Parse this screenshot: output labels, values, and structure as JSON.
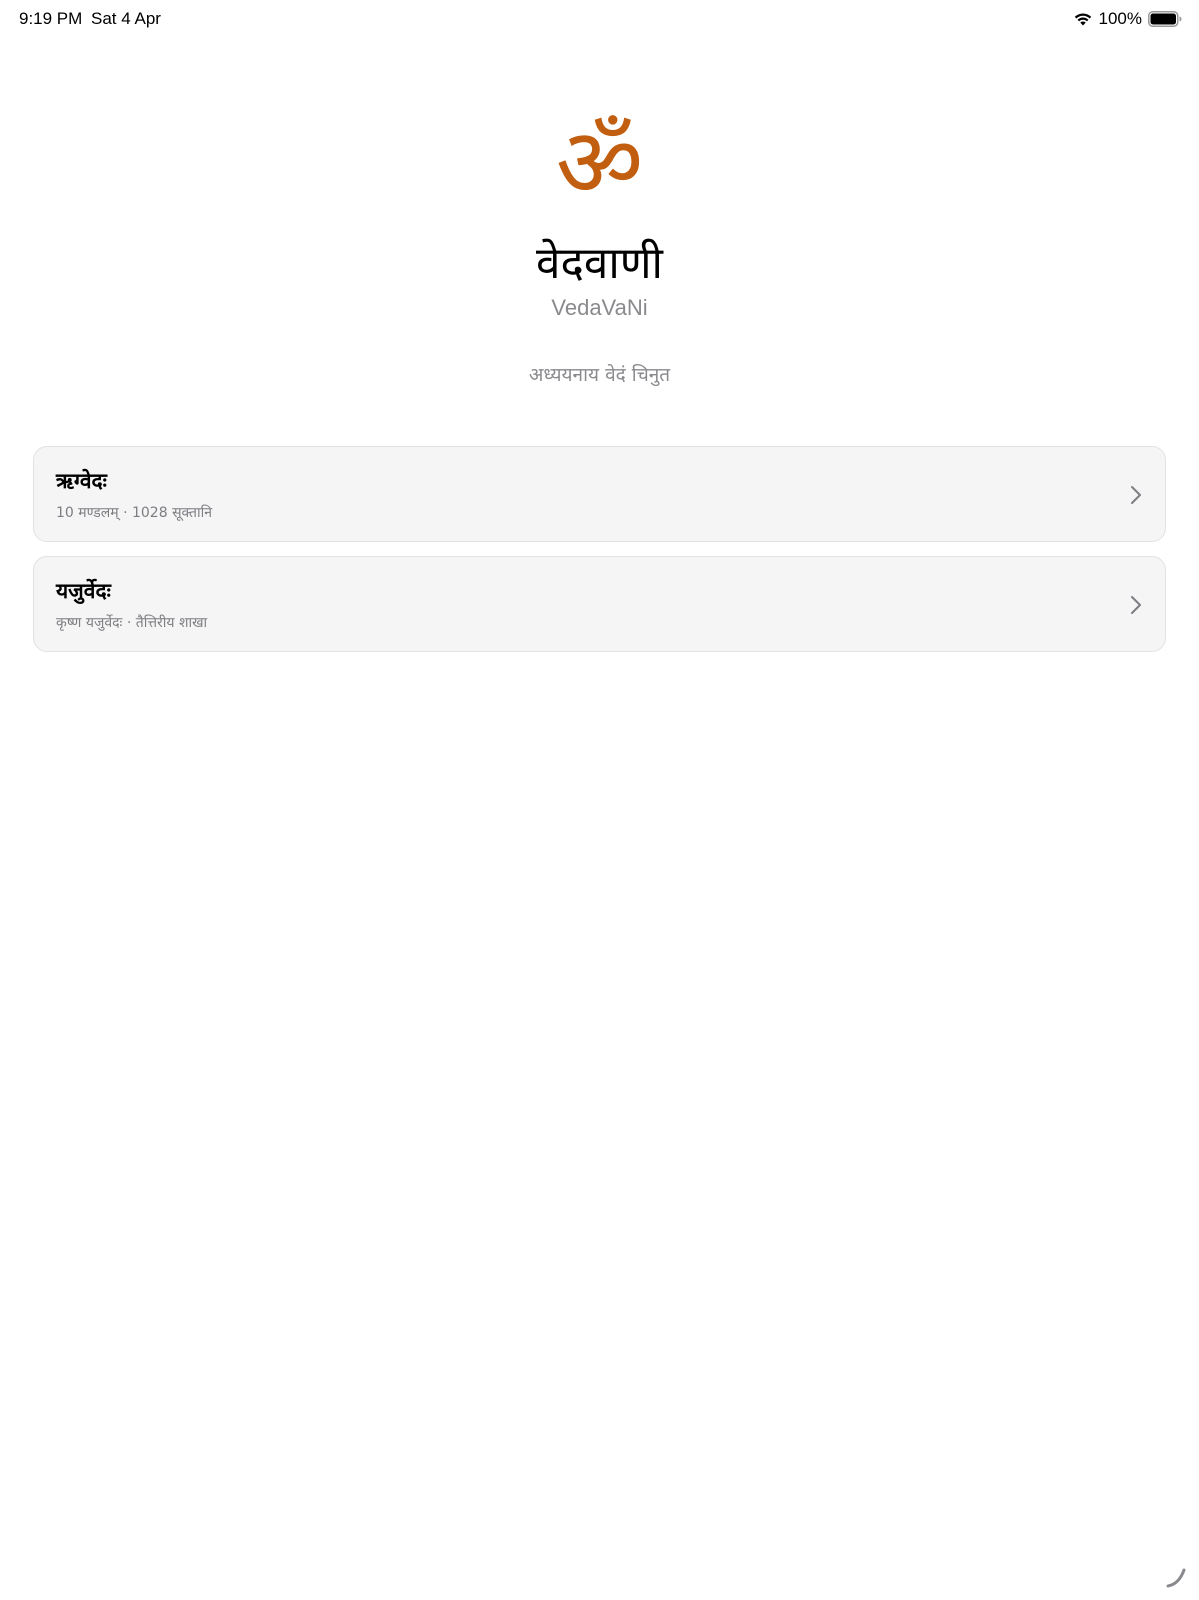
{
  "status_bar": {
    "time": "9:19 PM",
    "date": "Sat 4 Apr",
    "battery_percent": "100%",
    "icons": [
      "wifi-icon",
      "battery-icon"
    ]
  },
  "header": {
    "logo_glyph": "ॐ",
    "title": "वेदवाणी",
    "subtitle": "VedaVaNi",
    "prompt": "अध्ययनाय वेदं चिनुत"
  },
  "colors": {
    "accent": "#C25E0F",
    "card_background": "#F5F5F6",
    "secondary_text": "#8A8A8E"
  },
  "vedas": [
    {
      "title": "ऋग्वेदः",
      "subtitle": "10 मण्डलम् · 1028 सूक्तानि",
      "icon": "chevron-right-icon"
    },
    {
      "title": "यजुर्वेदः",
      "subtitle": "कृष्ण यजुर्वेदः · तैत्तिरीय शाखा",
      "icon": "chevron-right-icon"
    }
  ]
}
